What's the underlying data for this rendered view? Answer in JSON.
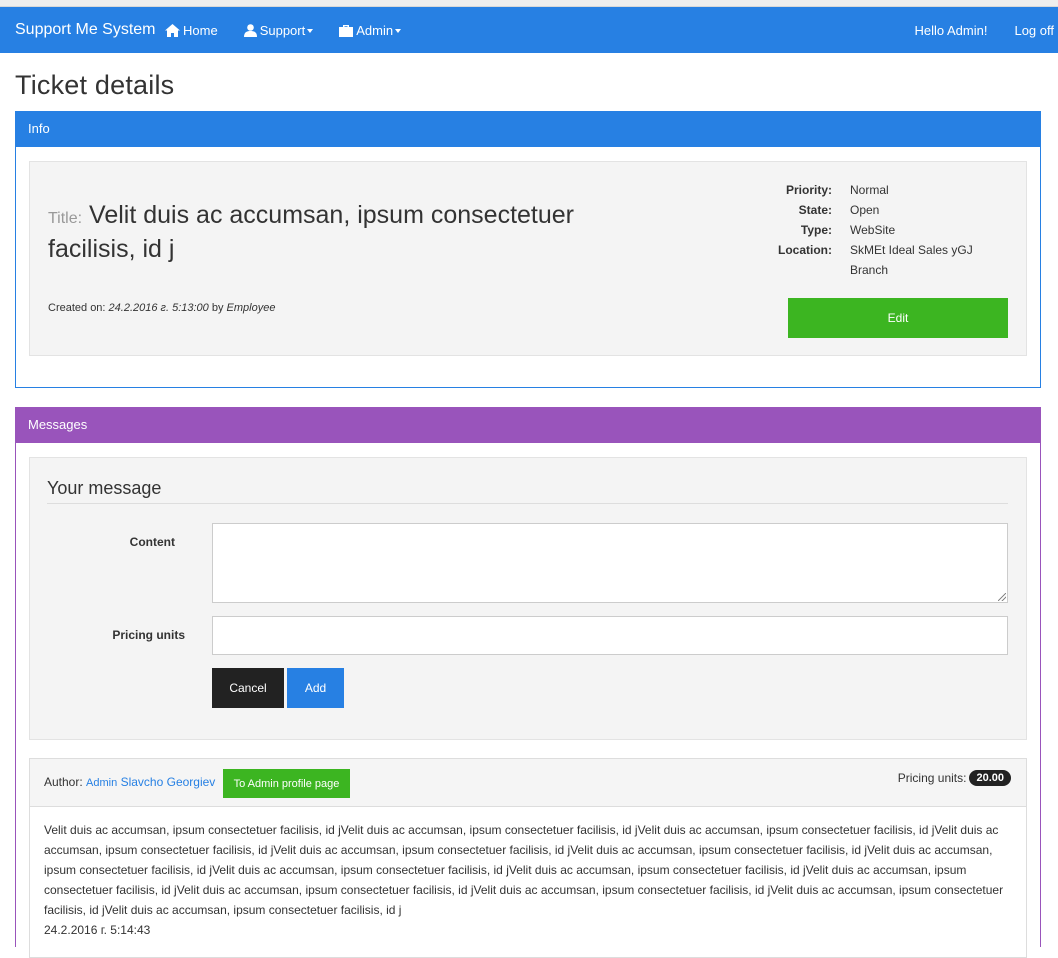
{
  "nav": {
    "brand": "Support Me System",
    "home": "Home",
    "support": "Support",
    "admin": "Admin",
    "greeting": "Hello Admin!",
    "logoff": "Log off"
  },
  "page": {
    "title": "Ticket details"
  },
  "info": {
    "heading": "Info",
    "title_prefix": "Title:",
    "title": "Velit duis ac accumsan, ipsum consectetuer facilisis, id j",
    "created_label": "Created on:",
    "created_date": "24.2.2016 г. 5:13:00",
    "by_label": "by",
    "created_by": "Employee",
    "props": [
      {
        "key": "Priority:",
        "value": "Normal"
      },
      {
        "key": "State:",
        "value": "Open"
      },
      {
        "key": "Type:",
        "value": "WebSite"
      },
      {
        "key": "Location:",
        "value": "SkMEt Ideal Sales yGJ Branch"
      }
    ],
    "edit_label": "Edit"
  },
  "messages": {
    "heading": "Messages",
    "form": {
      "legend": "Your message",
      "content_label": "Content",
      "content_value": "",
      "pricing_label": "Pricing units",
      "pricing_value": "",
      "cancel_label": "Cancel",
      "add_label": "Add"
    },
    "items": [
      {
        "author_label": "Author:",
        "author_role": "Admin",
        "author_name": "Slavcho Georgiev",
        "profile_button": "To Admin profile page",
        "pricing_label": "Pricing units:",
        "pricing_value": "20.00",
        "content": "Velit duis ac accumsan, ipsum consectetuer facilisis, id jVelit duis ac accumsan, ipsum consectetuer facilisis, id jVelit duis ac accumsan, ipsum consectetuer facilisis, id jVelit duis ac accumsan, ipsum consectetuer facilisis, id jVelit duis ac accumsan, ipsum consectetuer facilisis, id jVelit duis ac accumsan, ipsum consectetuer facilisis, id jVelit duis ac accumsan, ipsum consectetuer facilisis, id jVelit duis ac accumsan, ipsum consectetuer facilisis, id jVelit duis ac accumsan, ipsum consectetuer facilisis, id jVelit duis ac accumsan, ipsum consectetuer facilisis, id jVelit duis ac accumsan, ipsum consectetuer facilisis, id jVelit duis ac accumsan, ipsum consectetuer facilisis, id jVelit duis ac accumsan, ipsum consectetuer facilisis, id jVelit duis ac accumsan, ipsum consectetuer facilisis, id j",
        "date": "24.2.2016 г. 5:14:43"
      }
    ]
  }
}
